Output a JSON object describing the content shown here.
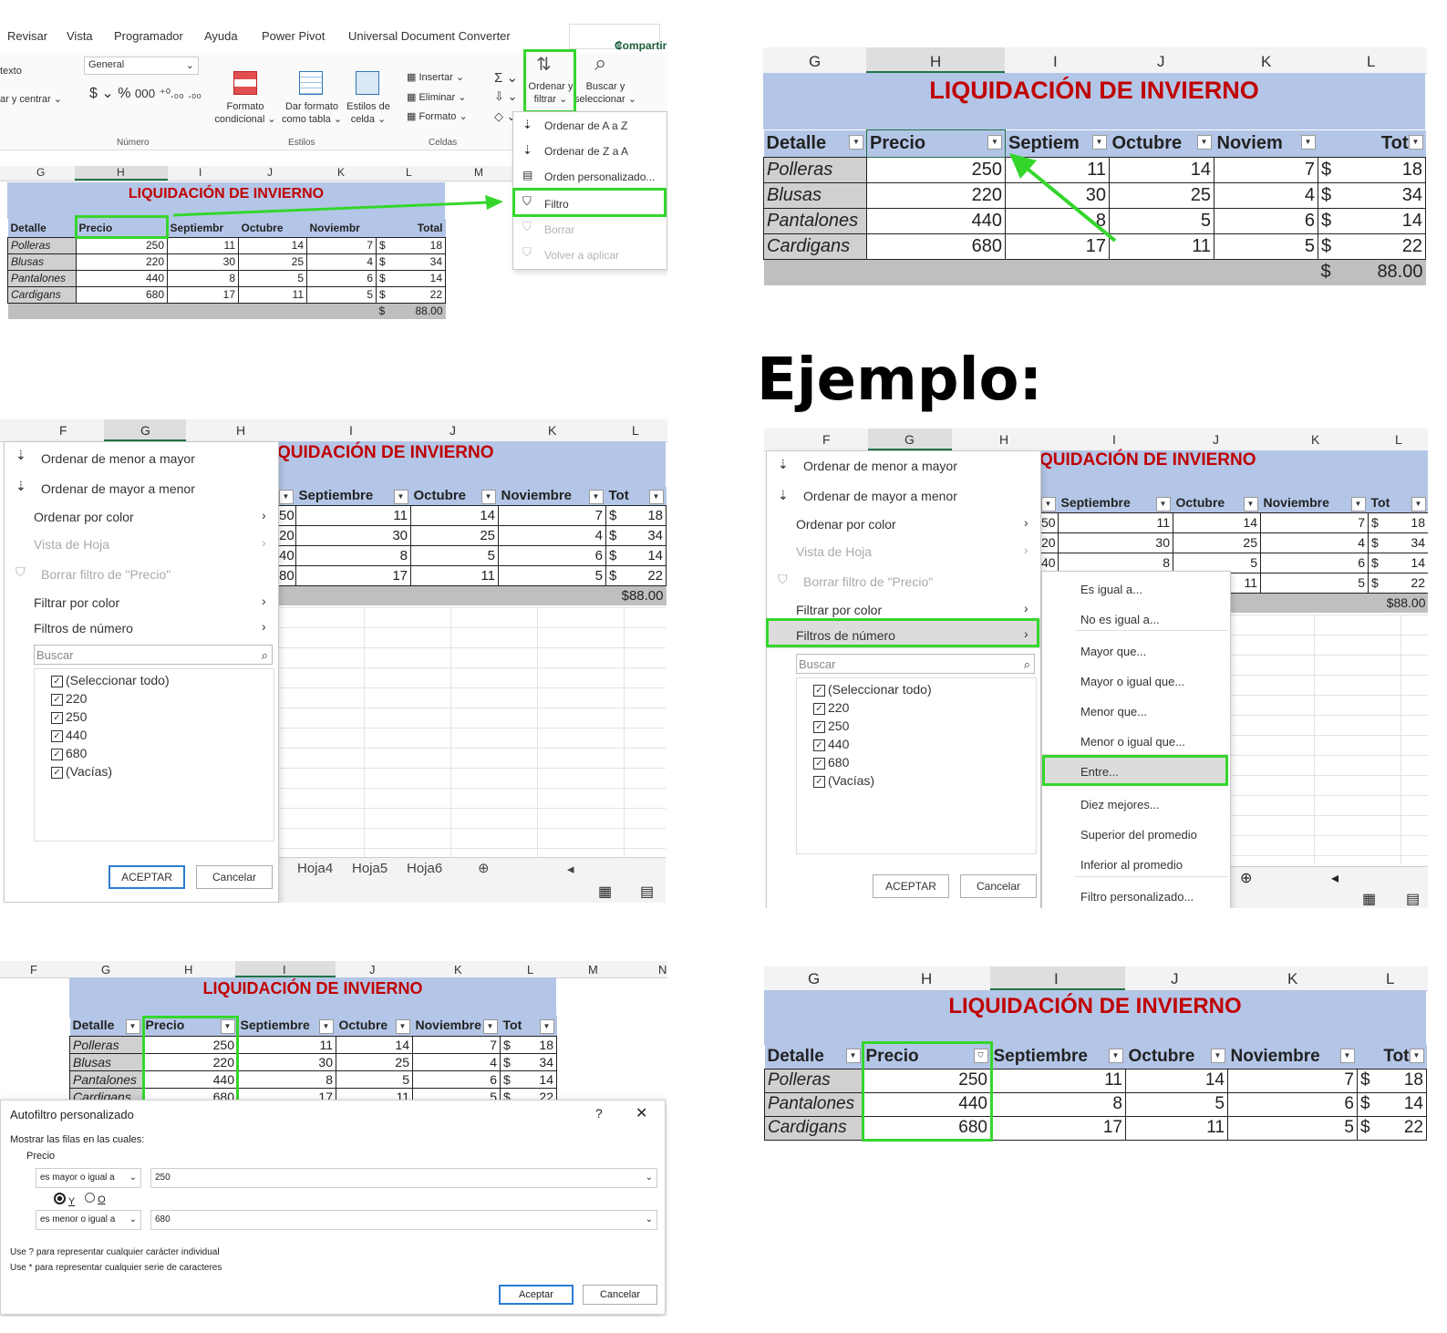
{
  "heading": "Ejemplo:",
  "p1": {
    "tabs": [
      "Revisar",
      "Vista",
      "Programador",
      "Ayuda",
      "Power Pivot",
      "Universal Document Converter"
    ],
    "share": "Compartir",
    "ribbon": {
      "texto": "texto",
      "merge": "ar y centrar",
      "number_format": "General",
      "numero_group": "Número",
      "formato_condicional": [
        "Formato",
        "condicional"
      ],
      "dar_formato": [
        "Dar formato",
        "como tabla"
      ],
      "estilos_celda": [
        "Estilos de",
        "celda"
      ],
      "estilos_group": "Estilos",
      "insertar": "Insertar",
      "eliminar": "Eliminar",
      "formato": "Formato",
      "celdas_group": "Celdas",
      "ordenar_filtrar": [
        "Ordenar y",
        "filtrar"
      ],
      "buscar": [
        "Buscar y",
        "seleccionar"
      ]
    },
    "menu": [
      "Ordenar de A a Z",
      "Ordenar de Z a A",
      "Orden personalizado...",
      "Filtro",
      "Borrar",
      "Volver a aplicar"
    ],
    "cols": [
      "G",
      "H",
      "I",
      "J",
      "K",
      "L",
      "M"
    ]
  },
  "table": {
    "title": "LIQUIDACIÓN DE INVIERNO",
    "headers_full": [
      "Detalle",
      "Precio",
      "Septiembre",
      "Octubre",
      "Noviembre",
      "Total"
    ],
    "headers_p1": [
      "Detalle",
      "Precio",
      "Septiembr",
      "Octubre",
      "Noviembr",
      "Total"
    ],
    "headers_p2": [
      "Detalle",
      "Precio",
      "Septiem",
      "Octubre",
      "Noviem",
      "Tot"
    ],
    "rows": [
      {
        "detalle": "Polleras",
        "precio": "250",
        "sep": "11",
        "oct": "14",
        "nov": "7",
        "total": "18"
      },
      {
        "detalle": "Blusas",
        "precio": "220",
        "sep": "30",
        "oct": "25",
        "nov": "4",
        "total": "34"
      },
      {
        "detalle": "Pantalones",
        "precio": "440",
        "sep": "8",
        "oct": "5",
        "nov": "6",
        "total": "14"
      },
      {
        "detalle": "Cardigans",
        "precio": "680",
        "sep": "17",
        "oct": "11",
        "nov": "5",
        "total": "22"
      }
    ],
    "currency": "$",
    "grand_total": "88.00",
    "grand_total_joined": "$88.00",
    "tot_short": "Tot"
  },
  "p2": {
    "cols": [
      "G",
      "H",
      "I",
      "J",
      "K",
      "L"
    ]
  },
  "filter_menu": {
    "items": [
      "Ordenar de menor a mayor",
      "Ordenar de mayor a menor",
      "Ordenar por color",
      "Vista de Hoja",
      "Borrar filtro de \"Precio\"",
      "Filtrar por color",
      "Filtros de número"
    ],
    "search": "Buscar",
    "checks": [
      "(Seleccionar todo)",
      "220",
      "250",
      "440",
      "680",
      "(Vacías)"
    ],
    "ok": "ACEPTAR",
    "cancel": "Cancelar",
    "sheets": [
      "Hoja4",
      "Hoja5",
      "Hoja6"
    ],
    "partial": [
      "50",
      "20",
      "40",
      "80"
    ],
    "partial_title": "QUIDACIÓN DE INVIERNO",
    "cols3": [
      "F",
      "G",
      "H",
      "I",
      "J",
      "K",
      "L"
    ]
  },
  "submenu": [
    "Es igual a...",
    "No es igual a...",
    "Mayor que...",
    "Mayor o igual que...",
    "Menor que...",
    "Menor o igual que...",
    "Entre...",
    "Diez mejores...",
    "Superior del promedio",
    "Inferior al promedio",
    "Filtro personalizado..."
  ],
  "p5": {
    "cols": [
      "F",
      "G",
      "H",
      "I",
      "J",
      "K",
      "L",
      "M",
      "N"
    ],
    "dialog_title": "Autofiltro personalizado",
    "help": "?",
    "show_rows": "Mostrar las filas en las cuales:",
    "field": "Precio",
    "op1": "es mayor o igual a",
    "val1": "250",
    "and": "Y",
    "or": "O",
    "op2": "es menor o igual a",
    "val2": "680",
    "hint1": "Use ? para representar cualquier carácter individual",
    "hint2": "Use * para representar cualquier serie de caracteres",
    "ok": "Aceptar",
    "cancel": "Cancelar"
  },
  "p6": {
    "cols": [
      "G",
      "H",
      "I",
      "J",
      "K",
      "L"
    ],
    "headers": [
      "Detalle",
      "Precio",
      "Septiembre",
      "Octubre",
      "Noviembre",
      "Tot"
    ],
    "rows": [
      {
        "detalle": "Polleras",
        "precio": "250",
        "sep": "11",
        "oct": "14",
        "nov": "7",
        "total": "18"
      },
      {
        "detalle": "Pantalones",
        "precio": "440",
        "sep": "8",
        "oct": "5",
        "nov": "6",
        "total": "14"
      },
      {
        "detalle": "Cardigans",
        "precio": "680",
        "sep": "17",
        "oct": "11",
        "nov": "5",
        "total": "22"
      }
    ]
  },
  "colors": {
    "highlight": "#34d62c",
    "banner": "#b4c6e7",
    "title": "#c00000",
    "detalle_bg": "#d0d0d0"
  }
}
